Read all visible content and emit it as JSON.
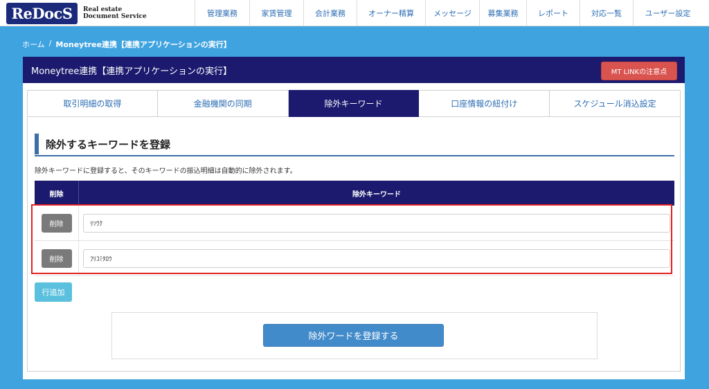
{
  "logo": {
    "mark": "ReDocS",
    "line1": "Real estate",
    "line2": "Document Service"
  },
  "nav": [
    {
      "label": "管理業務",
      "width": 79
    },
    {
      "label": "家賃管理",
      "width": 78
    },
    {
      "label": "会計業務",
      "width": 77
    },
    {
      "label": "オーナー精算",
      "width": 99
    },
    {
      "label": "メッセージ",
      "width": 78
    },
    {
      "label": "募集業務",
      "width": 68
    },
    {
      "label": "レポート",
      "width": 77
    },
    {
      "label": "対応一覧",
      "width": 77
    },
    {
      "label": "ユーザー設定",
      "width": 100
    }
  ],
  "breadcrumb": {
    "home": "ホーム",
    "sep": "/",
    "current": "Moneytree連携【連携アプリケーションの実行】"
  },
  "panel": {
    "title": "Moneytree連携【連携アプリケーションの実行】",
    "mt_button": "MT LINKの注意点"
  },
  "tabs": [
    {
      "label": "取引明細の取得",
      "active": false
    },
    {
      "label": "金融機関の同期",
      "active": false
    },
    {
      "label": "除外キーワード",
      "active": true
    },
    {
      "label": "口座情報の紐付け",
      "active": false
    },
    {
      "label": "スケジュール消込設定",
      "active": false
    }
  ],
  "section": {
    "title": "除外するキーワードを登録",
    "description": "除外キーワードに登録すると、そのキーワードの振込明細は自動的に除外されます。"
  },
  "table": {
    "headers": {
      "delete": "削除",
      "keyword": "除外キーワード"
    },
    "rows": [
      {
        "delete_label": "削除",
        "keyword": "ﾘｿｳｸ"
      },
      {
        "delete_label": "削除",
        "keyword": "ﾌﾘｺﾐﾀﾛｳ"
      }
    ]
  },
  "add_row_label": "行追加",
  "submit_label": "除外ワードを登録する",
  "colors": {
    "navy": "#1b1a6e",
    "bg_blue": "#3fa3e0",
    "red": "#d9534f",
    "highlight": "#e02020"
  }
}
